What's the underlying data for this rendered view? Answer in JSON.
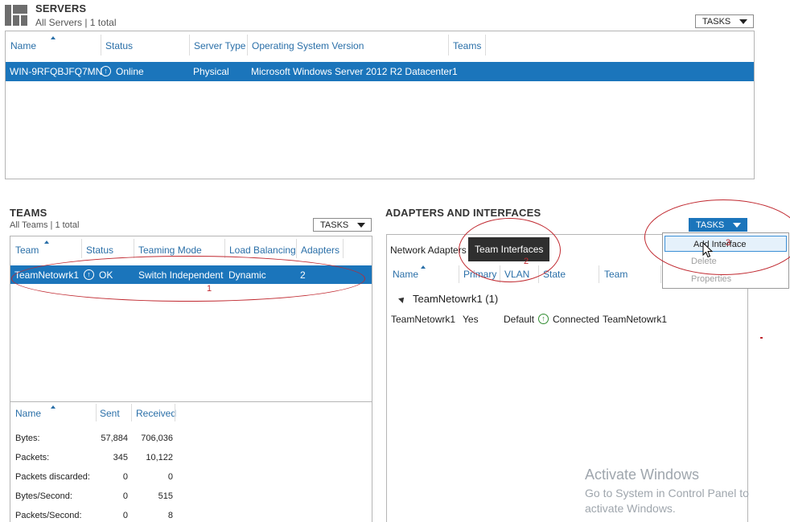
{
  "servers": {
    "title": "SERVERS",
    "subtitle": "All Servers | 1 total",
    "tasks_label": "TASKS",
    "columns": [
      "Name",
      "Status",
      "Server Type",
      "Operating System Version",
      "Teams"
    ],
    "row": {
      "name": "WIN-9RFQBJFQ7MN",
      "status": "Online",
      "server_type": "Physical",
      "os": "Microsoft Windows Server 2012 R2 Datacenter",
      "teams": "1"
    }
  },
  "teams": {
    "title": "TEAMS",
    "subtitle": "All Teams | 1 total",
    "tasks_label": "TASKS",
    "columns": [
      "Team",
      "Status",
      "Teaming Mode",
      "Load Balancing",
      "Adapters"
    ],
    "row": {
      "team": "TeamNetowrk1",
      "status": "OK",
      "mode": "Switch Independent",
      "load_balancing": "Dynamic",
      "adapters": "2"
    },
    "annotation": "1"
  },
  "stats": {
    "columns": [
      "Name",
      "Sent",
      "Received"
    ],
    "rows": [
      {
        "name": "Bytes:",
        "sent": "57,884",
        "received": "706,036"
      },
      {
        "name": "Packets:",
        "sent": "345",
        "received": "10,122"
      },
      {
        "name": "Packets discarded:",
        "sent": "0",
        "received": "0"
      },
      {
        "name": "Bytes/Second:",
        "sent": "0",
        "received": "515"
      },
      {
        "name": "Packets/Second:",
        "sent": "0",
        "received": "8"
      }
    ]
  },
  "adapters": {
    "title": "ADAPTERS AND INTERFACES",
    "tasks_label": "TASKS",
    "tabs": [
      "Network Adapters",
      "Team Interfaces"
    ],
    "columns": [
      "Name",
      "Primary",
      "VLAN",
      "State",
      "Team"
    ],
    "group": "TeamNetowrk1 (1)",
    "row": {
      "name": "TeamNetowrk1",
      "primary": "Yes",
      "vlan": "Default",
      "state": "Connected",
      "team": "TeamNetowrk1"
    },
    "tab_annotation": "2",
    "menu": {
      "items": [
        "Add Interface",
        "Delete",
        "Properties"
      ],
      "annotation": "3"
    }
  },
  "watermark": {
    "line1": "Activate Windows",
    "line2": "Go to System in Control Panel to",
    "line3": "activate Windows."
  },
  "colors": {
    "selection": "#1b75bb",
    "header_text": "#2a6fa8",
    "annotation_red": "#c0282f",
    "status_ok_green": "#2e8b2e"
  }
}
